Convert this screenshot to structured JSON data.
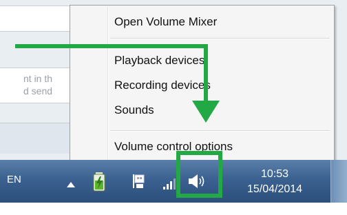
{
  "background": {
    "partial_text": "nt in th\nd send"
  },
  "menu": {
    "items": [
      {
        "label": "Open Volume Mixer"
      },
      {
        "label": "Playback devices"
      },
      {
        "label": "Recording devices"
      },
      {
        "label": "Sounds"
      },
      {
        "label": "Volume control options"
      }
    ]
  },
  "taskbar": {
    "language": "EN",
    "clock": {
      "time": "10:53",
      "date": "15/04/2014"
    }
  },
  "colors": {
    "annotation": "#22a845",
    "taskbar": "#3b6190",
    "menu_background": "#f5f5f5"
  },
  "icons": [
    "show-hidden-icons-arrow-icon",
    "battery-power-icon",
    "action-center-flag-icon",
    "network-signal-icon",
    "speaker-volume-icon"
  ]
}
